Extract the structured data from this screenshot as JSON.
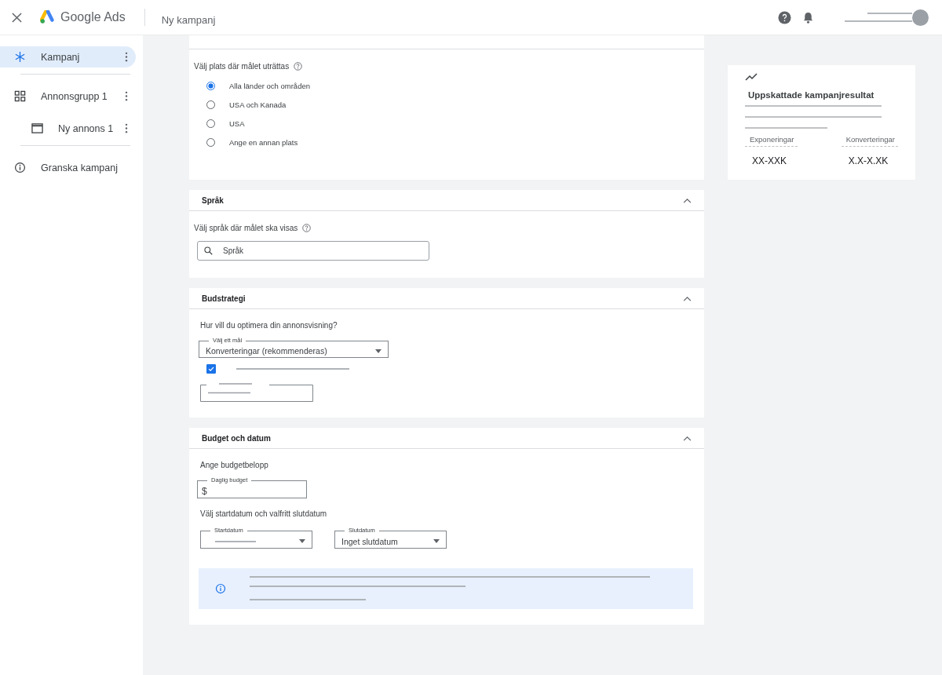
{
  "header": {
    "logo_text": "Google Ads",
    "title": "Ny kampanj"
  },
  "sidebar": {
    "items": [
      {
        "label": "Kampanj",
        "kind": "campaign",
        "selected": true
      },
      {
        "label": "Annonsgrupp 1",
        "kind": "adgroup",
        "selected": false,
        "children": [
          {
            "label": "Ny annons 1",
            "kind": "ad",
            "selected": false
          }
        ]
      },
      {
        "label": "Granska kampanj",
        "kind": "review",
        "selected": false
      }
    ]
  },
  "location": {
    "prompt": "Välj plats där målet uträttas",
    "options": [
      {
        "label": "Alla länder och områden",
        "selected": true
      },
      {
        "label": "USA och Kanada",
        "selected": false
      },
      {
        "label": "USA",
        "selected": false
      },
      {
        "label": "Ange en annan plats",
        "selected": false
      }
    ]
  },
  "language": {
    "title": "Språk",
    "expanded": true,
    "prompt": "Välj språk där målet ska visas",
    "search": {
      "placeholder": "Språk"
    }
  },
  "bidding": {
    "title": "Budstrategi",
    "expanded": true,
    "question": "Hur vill du optimera din annonsvisning?",
    "goal": {
      "label": "Välj ett mål",
      "value": "Konverteringar (rekommenderas)"
    },
    "checkbox": {
      "checked": true
    }
  },
  "budget": {
    "title": "Budget och datum",
    "expanded": true,
    "prompt": "Ange budgetbelopp",
    "daily": {
      "label": "Daglig budget",
      "prefix": "$"
    },
    "dates_prompt": "Välj startdatum och valfritt slutdatum",
    "start": {
      "label": "Startdatum"
    },
    "end": {
      "label": "Slutdatum",
      "value": "Inget slutdatum"
    }
  },
  "estimate": {
    "title": "Uppskattade kampanjresultat",
    "metrics": [
      {
        "label": "Exponeringar",
        "value": "XX-XXK"
      },
      {
        "label": "Konverteringar",
        "value": "X.X-X.XK"
      }
    ]
  }
}
